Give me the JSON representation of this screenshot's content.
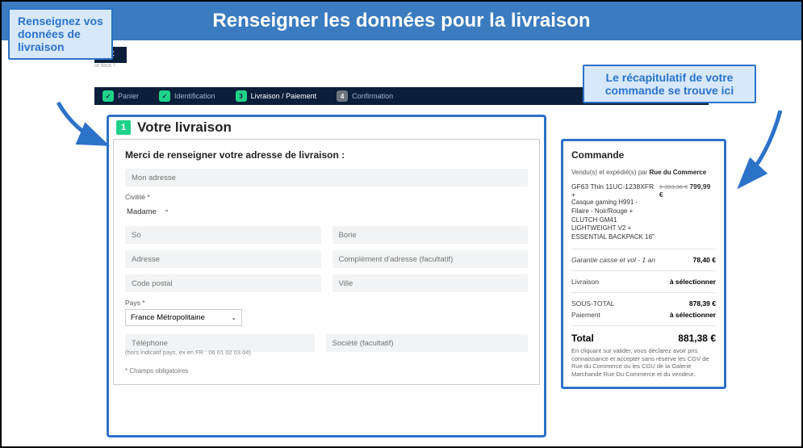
{
  "banner": {
    "title": "Renseigner les données pour la livraison"
  },
  "callouts": {
    "left": "Renseignez vos données de livraison",
    "right": "Le récapitulatif de votre commande se trouve ici"
  },
  "logo": {
    "text": "OC",
    "subtitle": "ur tous !"
  },
  "steps": {
    "items": [
      {
        "badge": "✓",
        "label": "Panier",
        "state": "done"
      },
      {
        "badge": "✓",
        "label": "Identification",
        "state": "done"
      },
      {
        "badge": "3",
        "label": "Livraison / Paiement",
        "state": "current"
      },
      {
        "badge": "4",
        "label": "Confirmation",
        "state": "todo"
      }
    ]
  },
  "delivery": {
    "badge": "1",
    "title": "Votre livraison",
    "heading": "Merci de renseigner votre adresse de livraison :",
    "fields": {
      "address_name": {
        "placeholder": "Mon adresse",
        "value": ""
      },
      "civility": {
        "label": "Civilité *",
        "selected": "Madame"
      },
      "firstname": {
        "value": "So"
      },
      "lastname": {
        "value": "Borie"
      },
      "address": {
        "placeholder": "Adresse",
        "value": ""
      },
      "address2": {
        "placeholder": "Complément d'adresse (facultatif)",
        "value": ""
      },
      "postal": {
        "placeholder": "Code postal",
        "value": ""
      },
      "city": {
        "placeholder": "Ville",
        "value": ""
      },
      "country": {
        "label": "Pays *",
        "selected": "France Métropolitaine"
      },
      "phone": {
        "placeholder": "Téléphone",
        "help": "(hors indicatif pays, ex en FR : 06 01 02 03 04)"
      },
      "company": {
        "placeholder": "Société (facultatif)"
      }
    },
    "required_note": "* Champs obligatoires"
  },
  "summary": {
    "title": "Commande",
    "sold_by_label": "Vendu(s) et expédié(s) par",
    "seller": "Rue du Commerce",
    "product": {
      "name": "GF63 Thin 11UC-1238XFR +",
      "old_price": "1 393,36 €",
      "price": "799,99 €",
      "lines": [
        "Casque gaming H991 -",
        "Filaire - Noir/Rouge +",
        "CLUTCH GM41",
        "LIGHTWEIGHT V2 +",
        "ESSENTIAL BACKPACK 16\""
      ]
    },
    "warranty": {
      "label": "Garantie casse et vol - 1 an",
      "value": "78,40 €"
    },
    "shipping": {
      "label": "Livraison",
      "value": "à sélectionner"
    },
    "subtotal": {
      "label": "SOUS-TOTAL",
      "value": "878,39 €"
    },
    "payment": {
      "label": "Paiement",
      "value": "à sélectionner"
    },
    "total": {
      "label": "Total",
      "value": "881,38 €"
    },
    "disclaimer": "En cliquant sur valider, vous déclarez avoir pris connaissance et accepter sans réserve les CGV de Rue du Commerce ou les CGU de la Galerie Marchande Rue Du Commerce et du vendeur."
  }
}
